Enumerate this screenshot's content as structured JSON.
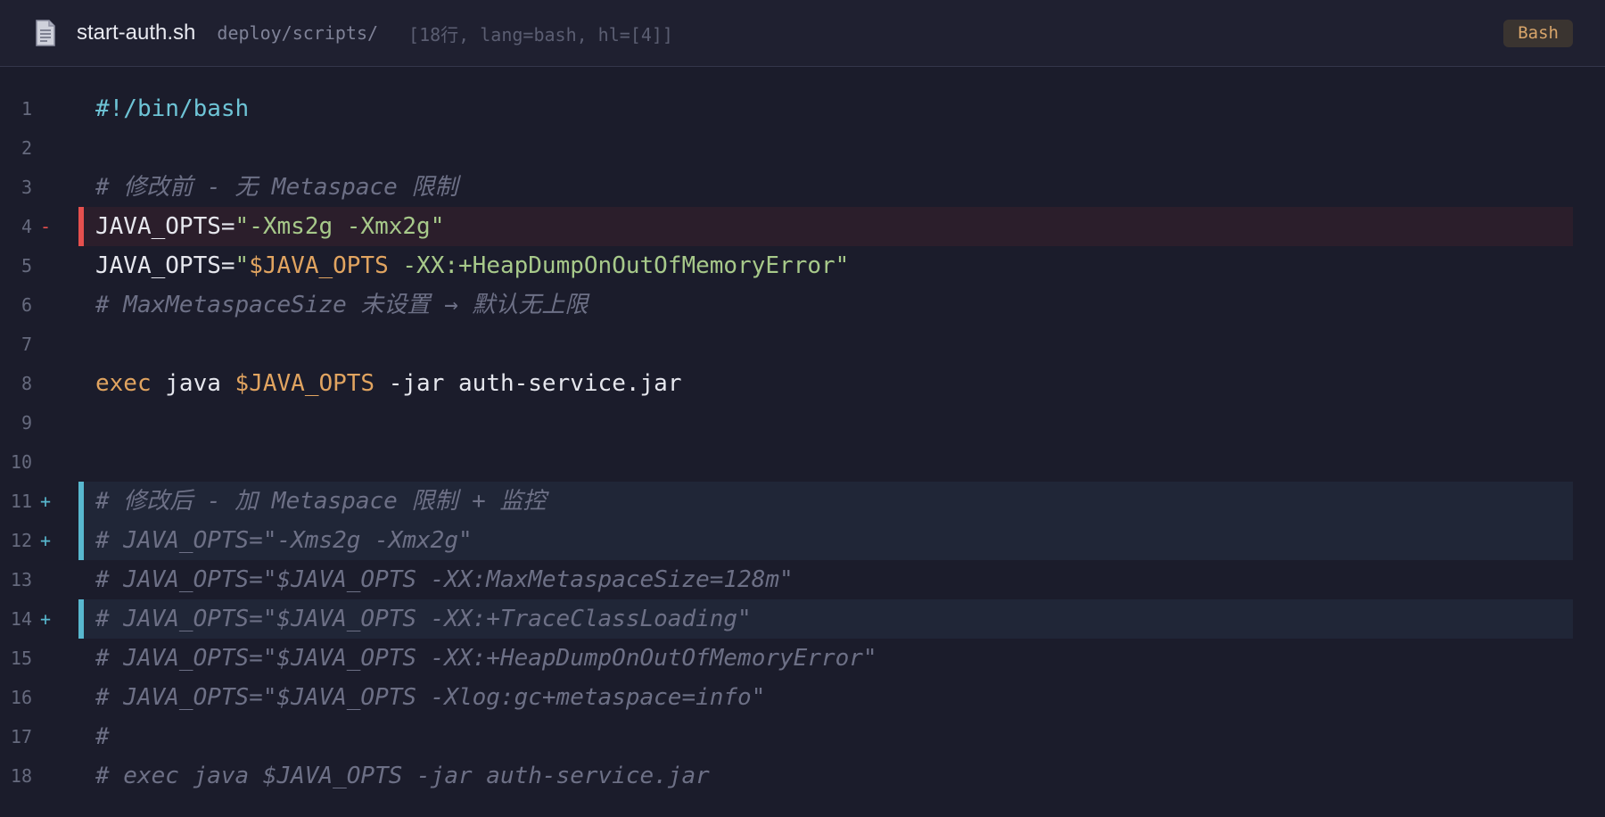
{
  "header": {
    "icon": "document-icon",
    "file_name": "start-auth.sh",
    "path": "deploy/scripts/",
    "meta": "[18行, lang=bash, hl=[4]]",
    "language_badge": "Bash"
  },
  "colors": {
    "background": "#1b1c2b",
    "added_marker": "#58b8cf",
    "removed_marker": "#e5504e",
    "comment": "#6d7086",
    "string": "#a7c98a",
    "variable": "#e1a460"
  },
  "lines": [
    {
      "num": "1",
      "sign": "",
      "status": "none",
      "tokens": [
        {
          "cls": "t-shebang",
          "text": "#!/bin/bash"
        }
      ]
    },
    {
      "num": "2",
      "sign": "",
      "status": "none",
      "tokens": []
    },
    {
      "num": "3",
      "sign": "",
      "status": "none",
      "tokens": [
        {
          "cls": "t-comment",
          "text": "# 修改前 - 无 Metaspace 限制"
        }
      ]
    },
    {
      "num": "4",
      "sign": "-",
      "status": "removed",
      "tokens": [
        {
          "cls": "t-plain",
          "text": "JAVA_OPTS="
        },
        {
          "cls": "t-string",
          "text": "\"-Xms2g -Xmx2g\""
        }
      ]
    },
    {
      "num": "5",
      "sign": "",
      "status": "none",
      "tokens": [
        {
          "cls": "t-plain",
          "text": "JAVA_OPTS="
        },
        {
          "cls": "t-string",
          "text": "\""
        },
        {
          "cls": "t-var",
          "text": "$JAVA_OPTS"
        },
        {
          "cls": "t-string",
          "text": " -XX:+HeapDumpOnOutOfMemoryError\""
        }
      ]
    },
    {
      "num": "6",
      "sign": "",
      "status": "none",
      "tokens": [
        {
          "cls": "t-comment",
          "text": "# MaxMetaspaceSize 未设置 → 默认无上限"
        }
      ]
    },
    {
      "num": "7",
      "sign": "",
      "status": "none",
      "tokens": []
    },
    {
      "num": "8",
      "sign": "",
      "status": "none",
      "tokens": [
        {
          "cls": "t-keyword",
          "text": "exec"
        },
        {
          "cls": "t-plain",
          "text": " java "
        },
        {
          "cls": "t-var",
          "text": "$JAVA_OPTS"
        },
        {
          "cls": "t-plain",
          "text": " -jar auth-service.jar"
        }
      ]
    },
    {
      "num": "9",
      "sign": "",
      "status": "none",
      "tokens": []
    },
    {
      "num": "10",
      "sign": "",
      "status": "none",
      "tokens": []
    },
    {
      "num": "11",
      "sign": "+",
      "status": "added",
      "tokens": [
        {
          "cls": "t-comment",
          "text": "# 修改后 - 加 Metaspace 限制 + 监控"
        }
      ]
    },
    {
      "num": "12",
      "sign": "+",
      "status": "added",
      "tokens": [
        {
          "cls": "t-comment",
          "text": "# JAVA_OPTS=\"-Xms2g -Xmx2g\""
        }
      ]
    },
    {
      "num": "13",
      "sign": "",
      "status": "none",
      "tokens": [
        {
          "cls": "t-comment",
          "text": "# JAVA_OPTS=\"$JAVA_OPTS -XX:MaxMetaspaceSize=128m\""
        }
      ]
    },
    {
      "num": "14",
      "sign": "+",
      "status": "added",
      "tokens": [
        {
          "cls": "t-comment",
          "text": "# JAVA_OPTS=\"$JAVA_OPTS -XX:+TraceClassLoading\""
        }
      ]
    },
    {
      "num": "15",
      "sign": "",
      "status": "none",
      "tokens": [
        {
          "cls": "t-comment",
          "text": "# JAVA_OPTS=\"$JAVA_OPTS -XX:+HeapDumpOnOutOfMemoryError\""
        }
      ]
    },
    {
      "num": "16",
      "sign": "",
      "status": "none",
      "tokens": [
        {
          "cls": "t-comment",
          "text": "# JAVA_OPTS=\"$JAVA_OPTS -Xlog:gc+metaspace=info\""
        }
      ]
    },
    {
      "num": "17",
      "sign": "",
      "status": "none",
      "tokens": [
        {
          "cls": "t-comment",
          "text": "#"
        }
      ]
    },
    {
      "num": "18",
      "sign": "",
      "status": "none",
      "tokens": [
        {
          "cls": "t-comment",
          "text": "# exec java $JAVA_OPTS -jar auth-service.jar"
        }
      ]
    }
  ]
}
